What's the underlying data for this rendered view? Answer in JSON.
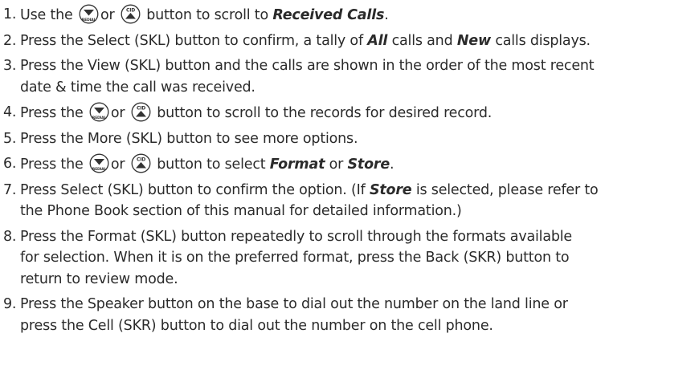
{
  "icons": {
    "down": {
      "name": "redial-down-button-icon",
      "label": "REDIAL"
    },
    "up": {
      "name": "cid-up-button-icon",
      "label": "CID"
    }
  },
  "steps": [
    {
      "number": "1.",
      "t1": "Use the",
      "t2": "or",
      "t3": "button to scroll to",
      "em1": "Received Calls",
      "t4": "."
    },
    {
      "number": "2.",
      "t1": "Press the Select (SKL) button to confirm, a tally of",
      "em1": "All",
      "t2": "calls and",
      "em2": "New",
      "t3": "calls displays."
    },
    {
      "number": "3.",
      "line1": "Press the View (SKL) button and the calls are shown in the order of the most recent",
      "line2": "date & time the call was received."
    },
    {
      "number": "4.",
      "t1": "Press the",
      "t2": "or",
      "t3": "button to scroll to the records for desired record."
    },
    {
      "number": "5.",
      "text": "Press the More (SKL) button to see more options."
    },
    {
      "number": "6.",
      "t1": "Press the",
      "t2": "or",
      "t3": "button to select",
      "em1": "Format",
      "t4": "or",
      "em2": "Store",
      "t5": "."
    },
    {
      "number": "7.",
      "t1": "Press Select (SKL) button to confirm the option. (If",
      "em1": "Store",
      "t2": "is selected, please refer to",
      "line2": "the Phone Book section of this manual for detailed information.)"
    },
    {
      "number": "8.",
      "line1": "Press the Format (SKL) button repeatedly to scroll through the formats available",
      "line2": "for selection. When it is on the preferred format, press the Back (SKR) button to",
      "line3": "return to review mode."
    },
    {
      "number": "9.",
      "line1": "Press the Speaker button on the base to dial out the number on the land line or",
      "line2": "press the Cell (SKR) button to dial out the number on the cell phone."
    }
  ]
}
